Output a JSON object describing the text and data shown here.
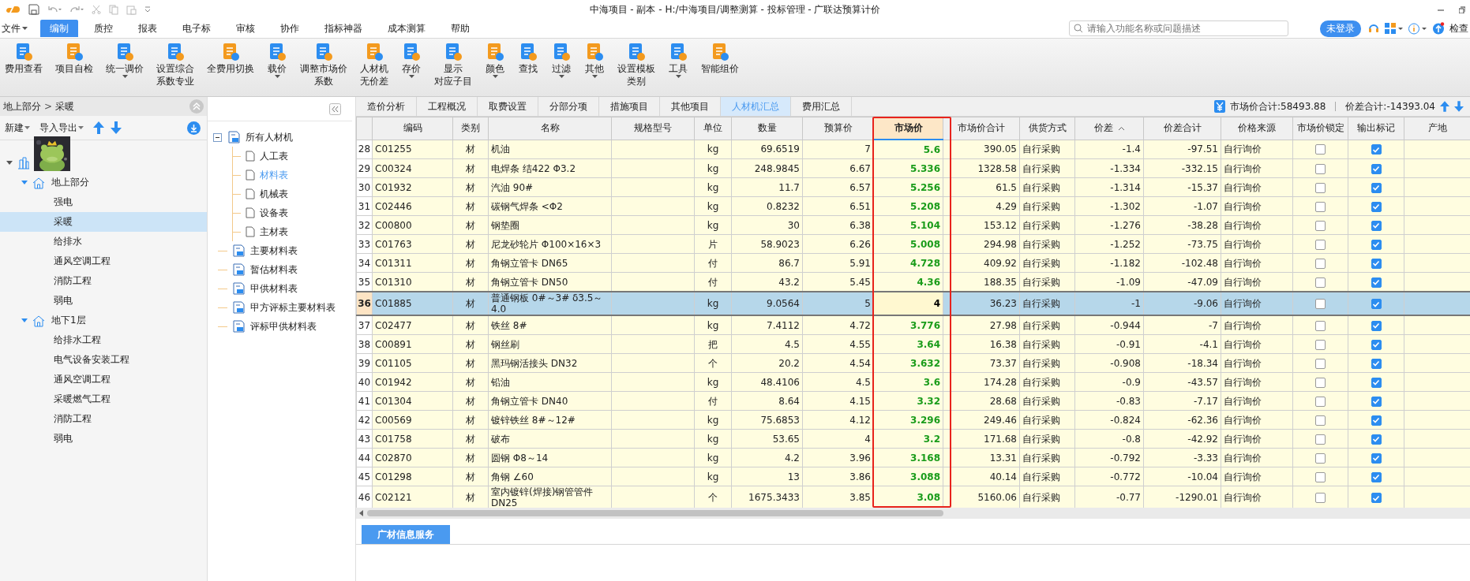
{
  "title_bar": {
    "title": "中海项目 - 副本  - H:/中海项目/调整测算 - 投标管理 - 广联达预算计价"
  },
  "menu": [
    {
      "label": "文件",
      "dropdown": true,
      "selected": false
    },
    {
      "label": "编制",
      "dropdown": false,
      "selected": true
    },
    {
      "label": "质控",
      "dropdown": false,
      "selected": false
    },
    {
      "label": "报表",
      "dropdown": false,
      "selected": false
    },
    {
      "label": "电子标",
      "dropdown": false,
      "selected": false
    },
    {
      "label": "审核",
      "dropdown": false,
      "selected": false
    },
    {
      "label": "协作",
      "dropdown": false,
      "selected": false
    },
    {
      "label": "指标神器",
      "dropdown": false,
      "selected": false
    },
    {
      "label": "成本测算",
      "dropdown": false,
      "selected": false
    },
    {
      "label": "帮助",
      "dropdown": false,
      "selected": false
    }
  ],
  "search": {
    "placeholder": "请输入功能名称或问题描述"
  },
  "login_button": "未登录",
  "check_update": "检查",
  "ribbon": [
    {
      "lines": [
        "费用查看"
      ],
      "dropdown": false
    },
    {
      "lines": [
        "项目自检"
      ],
      "dropdown": false
    },
    {
      "lines": [
        "统一调价"
      ],
      "dropdown": true
    },
    {
      "lines": [
        "设置综合",
        "系数专业"
      ],
      "dropdown": false
    },
    {
      "lines": [
        "全费用切换"
      ],
      "dropdown": false
    },
    {
      "lines": [
        "载价"
      ],
      "dropdown": true
    },
    {
      "lines": [
        "调整市场价",
        "系数"
      ],
      "dropdown": false
    },
    {
      "lines": [
        "人材机",
        "无价差"
      ],
      "dropdown": false
    },
    {
      "lines": [
        "存价"
      ],
      "dropdown": true
    },
    {
      "lines": [
        "显示",
        "对应子目"
      ],
      "dropdown": false
    },
    {
      "lines": [
        "颜色"
      ],
      "dropdown": true
    },
    {
      "lines": [
        "查找"
      ],
      "dropdown": false
    },
    {
      "lines": [
        "过滤"
      ],
      "dropdown": true
    },
    {
      "lines": [
        "其他"
      ],
      "dropdown": true
    },
    {
      "lines": [
        "设置模板",
        "类别"
      ],
      "dropdown": false
    },
    {
      "lines": [
        "工具"
      ],
      "dropdown": true
    },
    {
      "lines": [
        "智能组价"
      ],
      "dropdown": false
    }
  ],
  "breadcrumb": {
    "items": [
      "地上部分",
      "采暖"
    ],
    "separator": ">"
  },
  "left_toolbar": [
    {
      "label": "新建",
      "dropdown": true
    },
    {
      "label": "导入导出",
      "dropdown": true
    }
  ],
  "project_tree": {
    "expanded": true,
    "children": [
      {
        "label": "地上部分",
        "expanded": true,
        "selected": false,
        "children": [
          {
            "label": "强电",
            "selected": false
          },
          {
            "label": "采暖",
            "selected": true
          },
          {
            "label": "给排水",
            "selected": false
          },
          {
            "label": "通风空调工程",
            "selected": false
          },
          {
            "label": "消防工程",
            "selected": false
          },
          {
            "label": "弱电",
            "selected": false
          }
        ]
      },
      {
        "label": "地下1层",
        "expanded": true,
        "selected": false,
        "children": [
          {
            "label": "给排水工程",
            "selected": false
          },
          {
            "label": "电气设备安装工程",
            "selected": false
          },
          {
            "label": "通风空调工程",
            "selected": false
          },
          {
            "label": "采暖燃气工程",
            "selected": false
          },
          {
            "label": "消防工程",
            "selected": false
          },
          {
            "label": "弱电",
            "selected": false
          }
        ]
      }
    ]
  },
  "material_tree": [
    {
      "label": "所有人材机",
      "expanded": true,
      "selected": false,
      "children": [
        {
          "label": "人工表",
          "selected": false
        },
        {
          "label": "材料表",
          "selected": true
        },
        {
          "label": "机械表",
          "selected": false
        },
        {
          "label": "设备表",
          "selected": false
        },
        {
          "label": "主材表",
          "selected": false
        }
      ]
    },
    {
      "label": "主要材料表",
      "selected": false
    },
    {
      "label": "暂估材料表",
      "selected": false
    },
    {
      "label": "甲供材料表",
      "selected": false
    },
    {
      "label": "甲方评标主要材料表",
      "selected": false
    },
    {
      "label": "评标甲供材料表",
      "selected": false
    }
  ],
  "tabs": [
    {
      "label": "造价分析",
      "selected": false
    },
    {
      "label": "工程概况",
      "selected": false
    },
    {
      "label": "取费设置",
      "selected": false
    },
    {
      "label": "分部分项",
      "selected": false
    },
    {
      "label": "措施项目",
      "selected": false
    },
    {
      "label": "其他项目",
      "selected": false
    },
    {
      "label": "人材机汇总",
      "selected": true
    },
    {
      "label": "费用汇总",
      "selected": false
    }
  ],
  "summary": {
    "market_total": "市场价合计:58493.88",
    "diff_total": "价差合计:-14393.04"
  },
  "table": {
    "columns": [
      {
        "label": "编码",
        "highlighted": false,
        "sorted": false
      },
      {
        "label": "类别",
        "highlighted": false,
        "sorted": false
      },
      {
        "label": "名称",
        "highlighted": false,
        "sorted": false
      },
      {
        "label": "规格型号",
        "highlighted": false,
        "sorted": false
      },
      {
        "label": "单位",
        "highlighted": false,
        "sorted": false
      },
      {
        "label": "数量",
        "highlighted": false,
        "sorted": false
      },
      {
        "label": "预算价",
        "highlighted": false,
        "sorted": false
      },
      {
        "label": "市场价",
        "highlighted": true,
        "sorted": false
      },
      {
        "label": "市场价合计",
        "highlighted": false,
        "sorted": false
      },
      {
        "label": "供货方式",
        "highlighted": false,
        "sorted": false
      },
      {
        "label": "价差",
        "highlighted": false,
        "sorted": true
      },
      {
        "label": "价差合计",
        "highlighted": false,
        "sorted": false
      },
      {
        "label": "价格来源",
        "highlighted": false,
        "sorted": false
      },
      {
        "label": "市场价锁定",
        "highlighted": false,
        "sorted": false
      },
      {
        "label": "输出标记",
        "highlighted": false,
        "sorted": false
      },
      {
        "label": "产地",
        "highlighted": false,
        "sorted": false
      }
    ],
    "rows": [
      {
        "num": "28",
        "selected": false,
        "code": "C01255",
        "type": "材",
        "name": "机油",
        "unit": "kg",
        "qty": "69.6519",
        "budget": "7",
        "market": "5.6",
        "market_total": "390.05",
        "supply": "自行采购",
        "diff": "-1.4",
        "diff_total": "-97.51",
        "source": "自行询价",
        "locked": false,
        "output": true
      },
      {
        "num": "29",
        "selected": false,
        "code": "C00324",
        "type": "材",
        "name": "电焊条 结422 Φ3.2",
        "unit": "kg",
        "qty": "248.9845",
        "budget": "6.67",
        "market": "5.336",
        "market_total": "1328.58",
        "supply": "自行采购",
        "diff": "-1.334",
        "diff_total": "-332.15",
        "source": "自行询价",
        "locked": false,
        "output": true
      },
      {
        "num": "30",
        "selected": false,
        "code": "C01932",
        "type": "材",
        "name": "汽油 90#",
        "unit": "kg",
        "qty": "11.7",
        "budget": "6.57",
        "market": "5.256",
        "market_total": "61.5",
        "supply": "自行采购",
        "diff": "-1.314",
        "diff_total": "-15.37",
        "source": "自行询价",
        "locked": false,
        "output": true
      },
      {
        "num": "31",
        "selected": false,
        "code": "C02446",
        "type": "材",
        "name": "碳钢气焊条 <Φ2",
        "unit": "kg",
        "qty": "0.8232",
        "budget": "6.51",
        "market": "5.208",
        "market_total": "4.29",
        "supply": "自行采购",
        "diff": "-1.302",
        "diff_total": "-1.07",
        "source": "自行询价",
        "locked": false,
        "output": true
      },
      {
        "num": "32",
        "selected": false,
        "code": "C00800",
        "type": "材",
        "name": "钢垫圈",
        "unit": "kg",
        "qty": "30",
        "budget": "6.38",
        "market": "5.104",
        "market_total": "153.12",
        "supply": "自行采购",
        "diff": "-1.276",
        "diff_total": "-38.28",
        "source": "自行询价",
        "locked": false,
        "output": true
      },
      {
        "num": "33",
        "selected": false,
        "code": "C01763",
        "type": "材",
        "name": "尼龙砂轮片 Φ100×16×3",
        "unit": "片",
        "qty": "58.9023",
        "budget": "6.26",
        "market": "5.008",
        "market_total": "294.98",
        "supply": "自行采购",
        "diff": "-1.252",
        "diff_total": "-73.75",
        "source": "自行询价",
        "locked": false,
        "output": true
      },
      {
        "num": "34",
        "selected": false,
        "code": "C01311",
        "type": "材",
        "name": "角钢立管卡 DN65",
        "unit": "付",
        "qty": "86.7",
        "budget": "5.91",
        "market": "4.728",
        "market_total": "409.92",
        "supply": "自行采购",
        "diff": "-1.182",
        "diff_total": "-102.48",
        "source": "自行询价",
        "locked": false,
        "output": true
      },
      {
        "num": "35",
        "selected": false,
        "code": "C01310",
        "type": "材",
        "name": "角钢立管卡 DN50",
        "unit": "付",
        "qty": "43.2",
        "budget": "5.45",
        "market": "4.36",
        "market_total": "188.35",
        "supply": "自行采购",
        "diff": "-1.09",
        "diff_total": "-47.09",
        "source": "自行询价",
        "locked": false,
        "output": true
      },
      {
        "num": "36",
        "selected": true,
        "code": "C01885",
        "type": "材",
        "name": "普通钢板 0#～3# δ3.5～4.0",
        "unit": "kg",
        "qty": "9.0564",
        "budget": "5",
        "market": "4",
        "market_total": "36.23",
        "supply": "自行采购",
        "diff": "-1",
        "diff_total": "-9.06",
        "source": "自行询价",
        "locked": false,
        "output": true
      },
      {
        "num": "37",
        "selected": false,
        "code": "C02477",
        "type": "材",
        "name": "铁丝 8#",
        "unit": "kg",
        "qty": "7.4112",
        "budget": "4.72",
        "market": "3.776",
        "market_total": "27.98",
        "supply": "自行采购",
        "diff": "-0.944",
        "diff_total": "-7",
        "source": "自行询价",
        "locked": false,
        "output": true
      },
      {
        "num": "38",
        "selected": false,
        "code": "C00891",
        "type": "材",
        "name": "钢丝刷",
        "unit": "把",
        "qty": "4.5",
        "budget": "4.55",
        "market": "3.64",
        "market_total": "16.38",
        "supply": "自行采购",
        "diff": "-0.91",
        "diff_total": "-4.1",
        "source": "自行询价",
        "locked": false,
        "output": true
      },
      {
        "num": "39",
        "selected": false,
        "code": "C01105",
        "type": "材",
        "name": "黑玛钢活接头 DN32",
        "unit": "个",
        "qty": "20.2",
        "budget": "4.54",
        "market": "3.632",
        "market_total": "73.37",
        "supply": "自行采购",
        "diff": "-0.908",
        "diff_total": "-18.34",
        "source": "自行询价",
        "locked": false,
        "output": true
      },
      {
        "num": "40",
        "selected": false,
        "code": "C01942",
        "type": "材",
        "name": "铅油",
        "unit": "kg",
        "qty": "48.4106",
        "budget": "4.5",
        "market": "3.6",
        "market_total": "174.28",
        "supply": "自行采购",
        "diff": "-0.9",
        "diff_total": "-43.57",
        "source": "自行询价",
        "locked": false,
        "output": true
      },
      {
        "num": "41",
        "selected": false,
        "code": "C01304",
        "type": "材",
        "name": "角钢立管卡 DN40",
        "unit": "付",
        "qty": "8.64",
        "budget": "4.15",
        "market": "3.32",
        "market_total": "28.68",
        "supply": "自行采购",
        "diff": "-0.83",
        "diff_total": "-7.17",
        "source": "自行询价",
        "locked": false,
        "output": true
      },
      {
        "num": "42",
        "selected": false,
        "code": "C00569",
        "type": "材",
        "name": "镀锌铁丝 8#～12#",
        "unit": "kg",
        "qty": "75.6853",
        "budget": "4.12",
        "market": "3.296",
        "market_total": "249.46",
        "supply": "自行采购",
        "diff": "-0.824",
        "diff_total": "-62.36",
        "source": "自行询价",
        "locked": false,
        "output": true
      },
      {
        "num": "43",
        "selected": false,
        "code": "C01758",
        "type": "材",
        "name": "破布",
        "unit": "kg",
        "qty": "53.65",
        "budget": "4",
        "market": "3.2",
        "market_total": "171.68",
        "supply": "自行采购",
        "diff": "-0.8",
        "diff_total": "-42.92",
        "source": "自行询价",
        "locked": false,
        "output": true
      },
      {
        "num": "44",
        "selected": false,
        "code": "C02870",
        "type": "材",
        "name": "圆钢 Φ8～14",
        "unit": "kg",
        "qty": "4.2",
        "budget": "3.96",
        "market": "3.168",
        "market_total": "13.31",
        "supply": "自行采购",
        "diff": "-0.792",
        "diff_total": "-3.33",
        "source": "自行询价",
        "locked": false,
        "output": true
      },
      {
        "num": "45",
        "selected": false,
        "code": "C01298",
        "type": "材",
        "name": "角钢 ∠60",
        "unit": "kg",
        "qty": "13",
        "budget": "3.86",
        "market": "3.088",
        "market_total": "40.14",
        "supply": "自行采购",
        "diff": "-0.772",
        "diff_total": "-10.04",
        "source": "自行询价",
        "locked": false,
        "output": true
      },
      {
        "num": "46",
        "selected": false,
        "code": "C02121",
        "type": "材",
        "name": "室内镀锌(焊接)钢管管件DN25",
        "unit": "个",
        "qty": "1675.3433",
        "budget": "3.85",
        "market": "3.08",
        "market_total": "5160.06",
        "supply": "自行采购",
        "diff": "-0.77",
        "diff_total": "-1290.01",
        "source": "自行询价",
        "locked": false,
        "output": true
      }
    ]
  },
  "bottom_tabs": [
    {
      "label": "广材信息服务",
      "selected": true
    }
  ]
}
